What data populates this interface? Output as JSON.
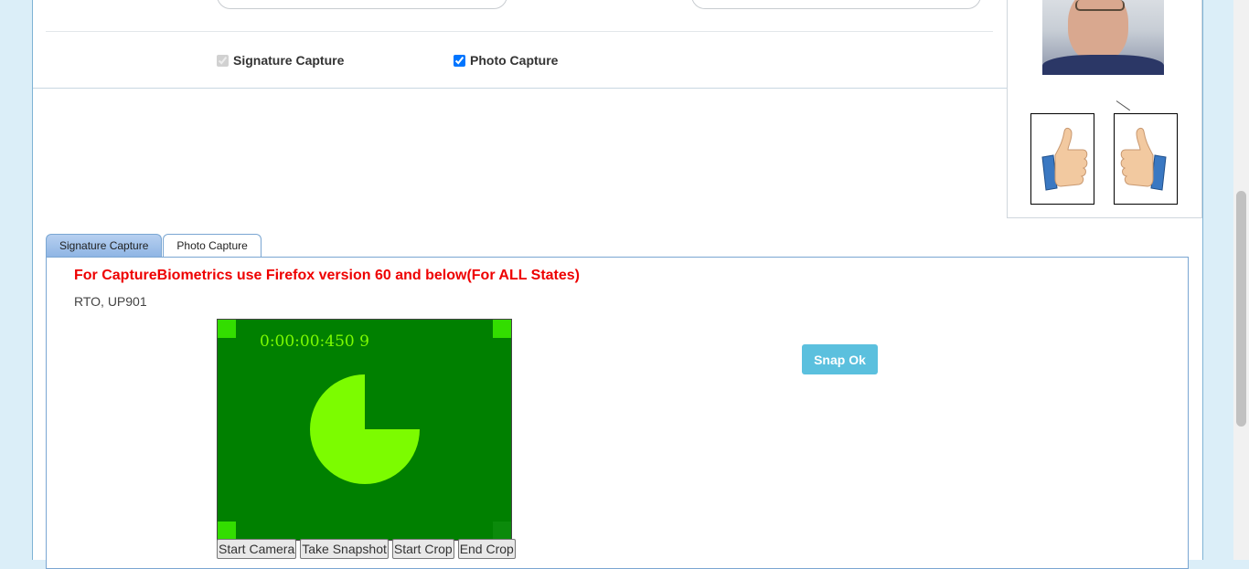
{
  "top_form": {
    "signature_capture_label": "Signature Capture",
    "photo_capture_label": "Photo Capture",
    "signature_checked": true,
    "photo_checked": true
  },
  "side_panel": {
    "left_thumb_icon": "thumbs-up-left-icon",
    "right_thumb_icon": "thumbs-up-right-icon"
  },
  "tabs": [
    {
      "label": "Signature Capture",
      "active": false
    },
    {
      "label": "Photo Capture",
      "active": true
    }
  ],
  "photo_panel": {
    "warning": "For CaptureBiometrics use Firefox version 60 and below(For ALL States)",
    "location": "RTO, UP901",
    "camera_timer": "0:00:00:450 9",
    "buttons": {
      "start_camera": "Start Camera",
      "take_snapshot": "Take Snapshot",
      "start_crop": "Start Crop",
      "end_crop": "End Crop"
    },
    "snap_ok": "Snap Ok"
  },
  "colors": {
    "warning": "#ee0000",
    "camera_bg": "#008000",
    "camera_accent": "#7cfc00",
    "snap_button": "#5bc0de"
  }
}
